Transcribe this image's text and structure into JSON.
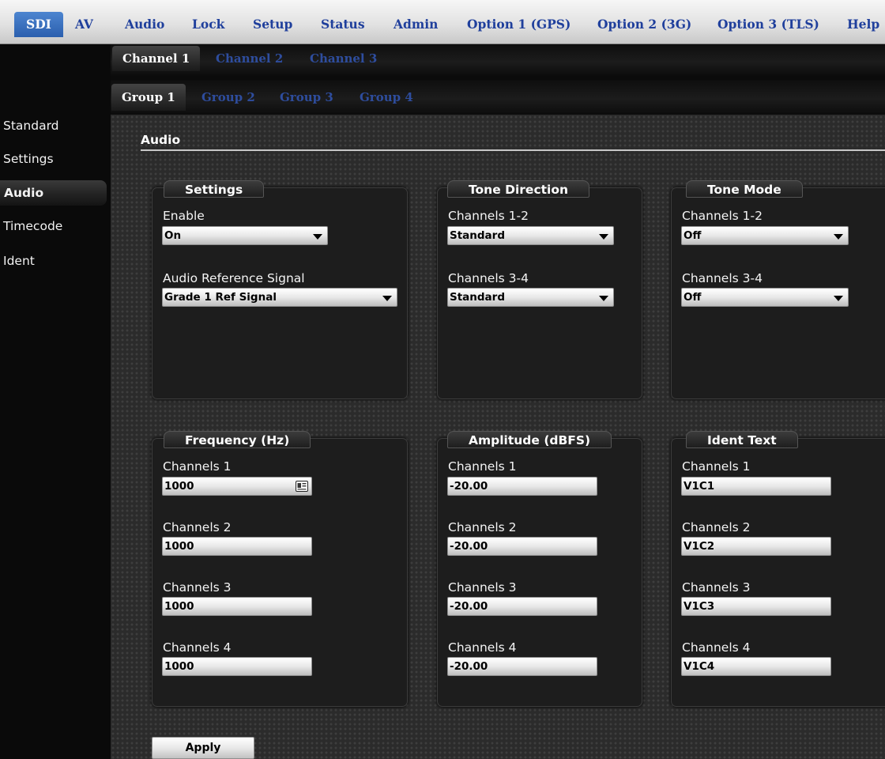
{
  "top_nav": {
    "items": [
      {
        "label": "SDI",
        "active": true
      },
      {
        "label": "AV"
      },
      {
        "label": "Audio"
      },
      {
        "label": "Lock"
      },
      {
        "label": "Setup"
      },
      {
        "label": "Status"
      },
      {
        "label": "Admin"
      },
      {
        "label": "Option 1 (GPS)"
      },
      {
        "label": "Option 2 (3G)"
      },
      {
        "label": "Option 3 (TLS)"
      },
      {
        "label": "Help"
      }
    ]
  },
  "channel_tabs": [
    {
      "label": "Channel 1",
      "active": true
    },
    {
      "label": "Channel 2"
    },
    {
      "label": "Channel 3"
    }
  ],
  "group_tabs": [
    {
      "label": "Group 1",
      "active": true
    },
    {
      "label": "Group 2"
    },
    {
      "label": "Group 3"
    },
    {
      "label": "Group 4"
    }
  ],
  "sidebar": {
    "items": [
      {
        "label": "Standard"
      },
      {
        "label": "Settings"
      },
      {
        "label": "Audio",
        "active": true
      },
      {
        "label": "Timecode"
      },
      {
        "label": "Ident"
      }
    ]
  },
  "main": {
    "section_title": "Audio",
    "settings": {
      "title": "Settings",
      "enable_label": "Enable",
      "enable_value": "On",
      "ref_label": "Audio Reference Signal",
      "ref_value": "Grade 1 Ref Signal"
    },
    "tone_direction": {
      "title": "Tone Direction",
      "ch12_label": "Channels 1-2",
      "ch12_value": "Standard",
      "ch34_label": "Channels 3-4",
      "ch34_value": "Standard"
    },
    "tone_mode": {
      "title": "Tone Mode",
      "ch12_label": "Channels 1-2",
      "ch12_value": "Off",
      "ch34_label": "Channels 3-4",
      "ch34_value": "Off"
    },
    "frequency": {
      "title": "Frequency (Hz)",
      "fields": [
        {
          "label": "Channels 1",
          "value": "1000"
        },
        {
          "label": "Channels 2",
          "value": "1000"
        },
        {
          "label": "Channels 3",
          "value": "1000"
        },
        {
          "label": "Channels 4",
          "value": "1000"
        }
      ]
    },
    "amplitude": {
      "title": "Amplitude (dBFS)",
      "fields": [
        {
          "label": "Channels 1",
          "value": "-20.00"
        },
        {
          "label": "Channels 2",
          "value": "-20.00"
        },
        {
          "label": "Channels 3",
          "value": "-20.00"
        },
        {
          "label": "Channels 4",
          "value": "-20.00"
        }
      ]
    },
    "ident_text": {
      "title": "Ident Text",
      "fields": [
        {
          "label": "Channels 1",
          "value": "V1C1"
        },
        {
          "label": "Channels 2",
          "value": "V1C2"
        },
        {
          "label": "Channels 3",
          "value": "V1C3"
        },
        {
          "label": "Channels 4",
          "value": "V1C4"
        }
      ]
    },
    "apply_label": "Apply"
  }
}
